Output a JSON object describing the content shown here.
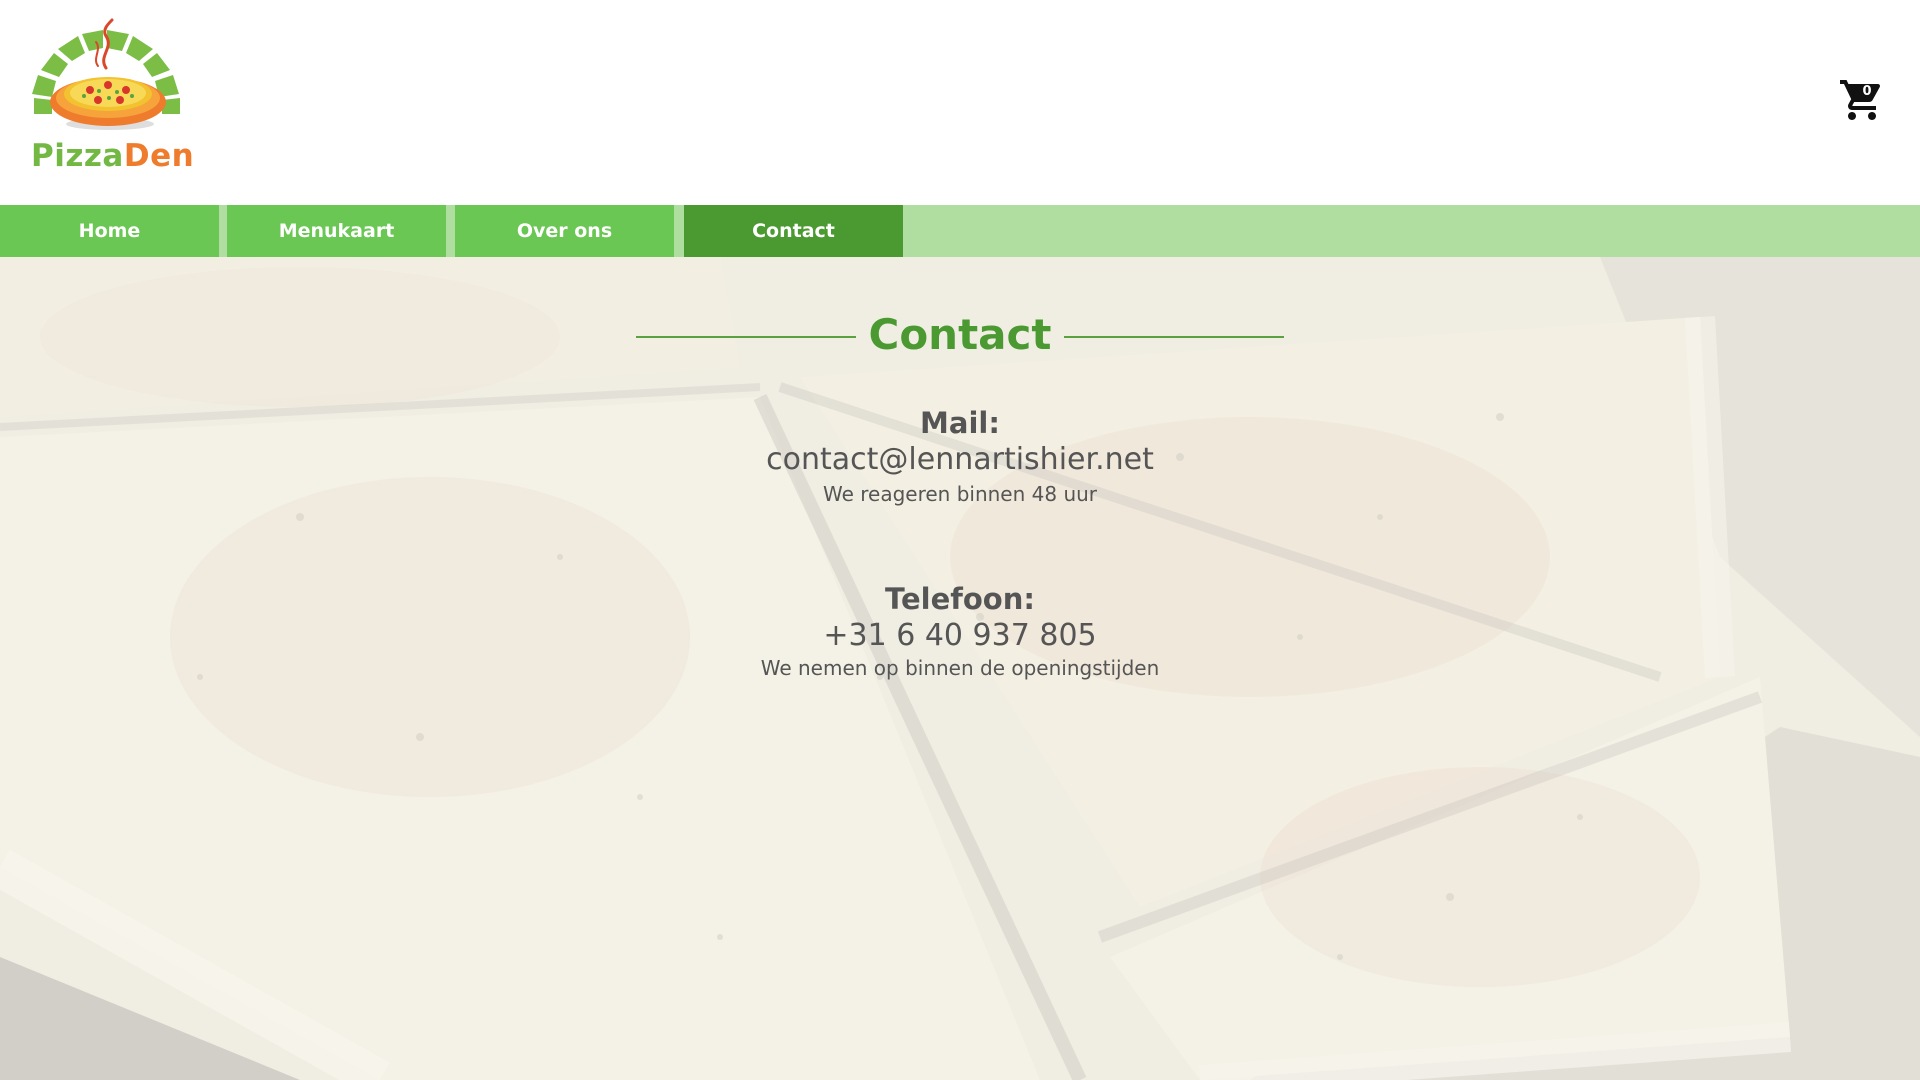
{
  "brand": {
    "name_part1": "Pizza",
    "name_part2": "Den",
    "color_green": "#72b843",
    "color_orange": "#ef7b2d"
  },
  "cart": {
    "icon": "shopping-cart-icon",
    "count": "0"
  },
  "nav": {
    "items": [
      {
        "label": "Home"
      },
      {
        "label": "Menukaart"
      },
      {
        "label": "Over ons"
      },
      {
        "label": "Contact"
      }
    ],
    "active": "Contact",
    "color_item": "#6ac753",
    "color_active": "#4a9a31",
    "color_bar": "#b0dea1"
  },
  "contact": {
    "title": "Contact",
    "mail": {
      "label": "Mail:",
      "value": "contact@lennartishier.net",
      "note": "We reageren binnen 48 uur"
    },
    "phone": {
      "label": "Telefoon:",
      "value": "+31 6 40 937 805",
      "note": "We nemen op binnen de openingstijden"
    }
  }
}
